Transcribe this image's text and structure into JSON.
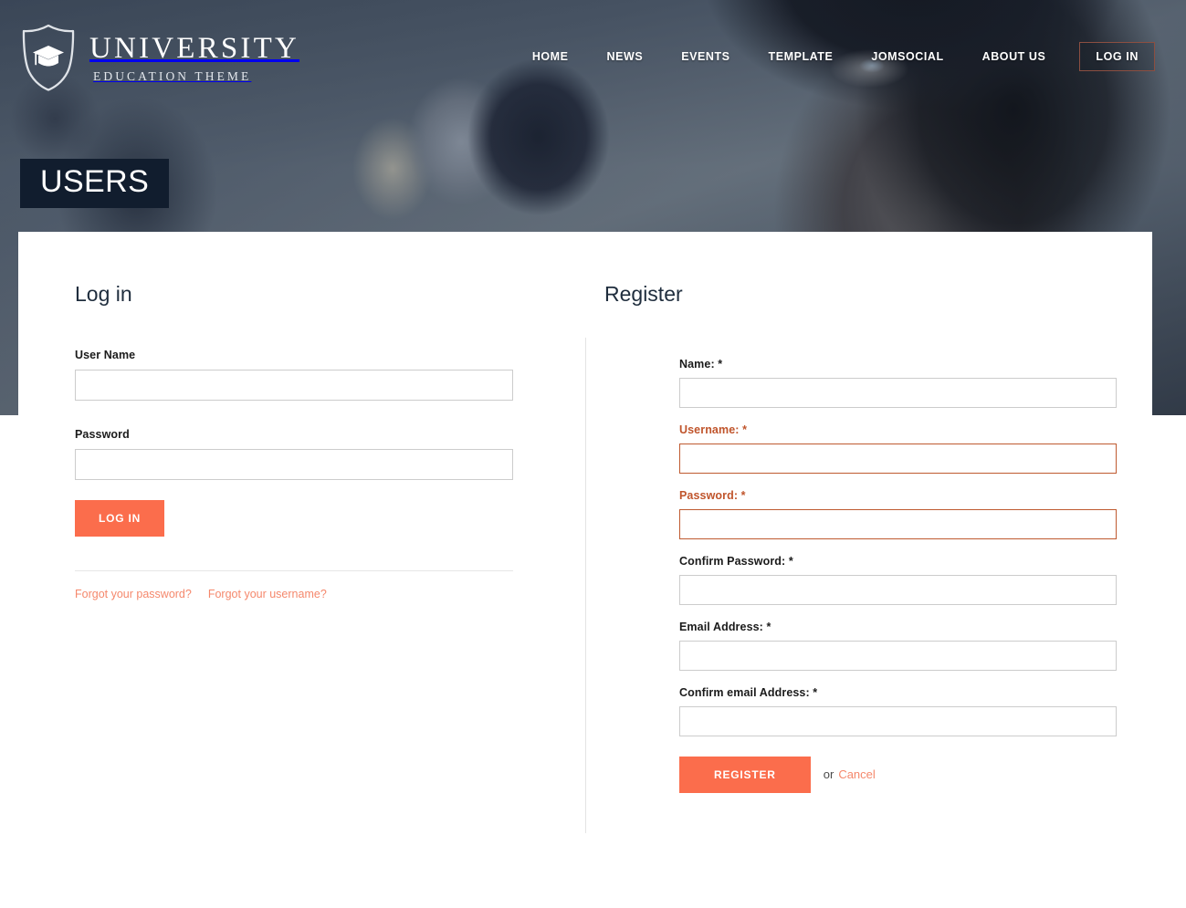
{
  "brand": {
    "title": "UNIVERSITY",
    "subtitle": "EDUCATION THEME",
    "logo_icon": "shield-graduation-cap-icon"
  },
  "nav": {
    "items": [
      {
        "label": "HOME"
      },
      {
        "label": "NEWS"
      },
      {
        "label": "EVENTS"
      },
      {
        "label": "TEMPLATE"
      },
      {
        "label": "JOMSOCIAL"
      },
      {
        "label": "ABOUT US"
      }
    ],
    "login_label": "LOG IN"
  },
  "page": {
    "title": "USERS"
  },
  "login": {
    "heading": "Log in",
    "username_label": "User Name",
    "username_value": "",
    "username_placeholder": "",
    "password_label": "Password",
    "password_value": "",
    "password_placeholder": "",
    "submit_label": "LOG IN",
    "forgot_password_label": "Forgot your password?",
    "forgot_username_label": "Forgot your username?"
  },
  "register": {
    "heading": "Register",
    "fields": [
      {
        "label": "Name: *",
        "value": "",
        "invalid": false
      },
      {
        "label": "Username: *",
        "value": "",
        "invalid": true
      },
      {
        "label": "Password: *",
        "value": "",
        "invalid": true
      },
      {
        "label": "Confirm Password: *",
        "value": "",
        "invalid": false
      },
      {
        "label": "Email Address: *",
        "value": "",
        "invalid": false
      },
      {
        "label": "Confirm email Address: *",
        "value": "",
        "invalid": false
      }
    ],
    "submit_label": "REGISTER",
    "or_label": "or",
    "cancel_label": "Cancel"
  },
  "colors": {
    "accent_orange": "#fb6d4c",
    "link_salmon": "#f5886c",
    "invalid_orange": "#c0552c",
    "dark_navy": "#111d2e",
    "nav_login_border": "#8c4f41",
    "heading_navy": "#1f2d3d"
  }
}
